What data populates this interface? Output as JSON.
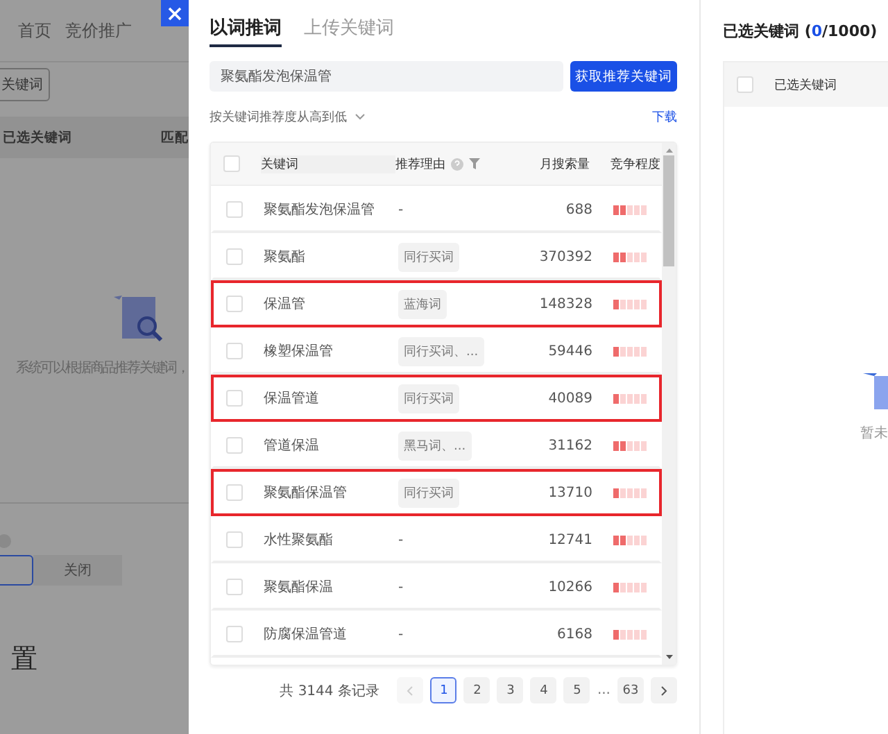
{
  "background_page": {
    "nav": [
      "首页",
      "竞价推广"
    ],
    "keyword_button": "关键词",
    "table_header": [
      "已选关键词",
      "匹配"
    ],
    "empty_text": "系统可以根据商品推荐关键词，",
    "segments": [
      {
        "selected": true
      },
      {
        "label": "关闭",
        "selected": false
      }
    ],
    "section_title": "置"
  },
  "dialog": {
    "tabs": [
      {
        "label": "以词推词",
        "selected": true
      },
      {
        "label": "上传关键词",
        "selected": false
      }
    ],
    "search": {
      "value": "聚氨酯发泡保温管"
    },
    "fetch_button": "获取推荐关键词",
    "sort": "按关键词推荐度从高到低",
    "download": "下载",
    "table": {
      "columns": [
        "关键词",
        "推荐理由",
        "月搜索量",
        "竞争程度"
      ],
      "header_checked": false,
      "rows": [
        {
          "keyword": "聚氨酯发泡保温管",
          "reason": {
            "kind": "plain",
            "text": "-"
          },
          "volume": "688",
          "level": 0.4,
          "checked": false,
          "highlighted": false
        },
        {
          "keyword": "聚氨酯",
          "reason": {
            "kind": "tag",
            "text": "同行买词"
          },
          "volume": "370392",
          "level": 0.4,
          "checked": false,
          "highlighted": false
        },
        {
          "keyword": "保温管",
          "reason": {
            "kind": "tag",
            "text": "蓝海词"
          },
          "volume": "148328",
          "level": 0.2,
          "checked": false,
          "highlighted": true
        },
        {
          "keyword": "橡塑保温管",
          "reason": {
            "kind": "tag",
            "text": "同行买词、..."
          },
          "volume": "59446",
          "level": 0.2,
          "checked": false,
          "highlighted": false
        },
        {
          "keyword": "保温管道",
          "reason": {
            "kind": "tag",
            "text": "同行买词"
          },
          "volume": "40089",
          "level": 0.2,
          "checked": false,
          "highlighted": true
        },
        {
          "keyword": "管道保温",
          "reason": {
            "kind": "tag",
            "text": "黑马词、..."
          },
          "volume": "31162",
          "level": 0.4,
          "checked": false,
          "highlighted": false
        },
        {
          "keyword": "聚氨酯保温管",
          "reason": {
            "kind": "tag",
            "text": "同行买词"
          },
          "volume": "13710",
          "level": 0.2,
          "checked": false,
          "highlighted": true
        },
        {
          "keyword": "水性聚氨酯",
          "reason": {
            "kind": "plain",
            "text": "-"
          },
          "volume": "12741",
          "level": 0.4,
          "checked": false,
          "highlighted": false
        },
        {
          "keyword": "聚氨酯保温",
          "reason": {
            "kind": "plain",
            "text": "-"
          },
          "volume": "10266",
          "level": 0.2,
          "checked": false,
          "highlighted": false
        },
        {
          "keyword": "防腐保温管道",
          "reason": {
            "kind": "plain",
            "text": "-"
          },
          "volume": "6168",
          "level": 0.2,
          "checked": false,
          "highlighted": false
        }
      ]
    },
    "pagination": {
      "total": "共 3144 条记录",
      "prev_disabled": true,
      "next_disabled": false,
      "items": [
        {
          "kind": "page",
          "label": "1",
          "selected": true
        },
        {
          "kind": "page",
          "label": "2",
          "selected": false
        },
        {
          "kind": "page",
          "label": "3",
          "selected": false
        },
        {
          "kind": "page",
          "label": "4",
          "selected": false
        },
        {
          "kind": "page",
          "label": "5",
          "selected": false
        },
        {
          "kind": "ellipsis",
          "label": "..."
        },
        {
          "kind": "page",
          "label": "63",
          "selected": false
        }
      ]
    }
  },
  "selected_panel": {
    "title": "已选关键词 (",
    "count": "0",
    "title_end": "/1000)",
    "header_checked": false,
    "column": "已选关键词",
    "empty_text": "暂未"
  }
}
